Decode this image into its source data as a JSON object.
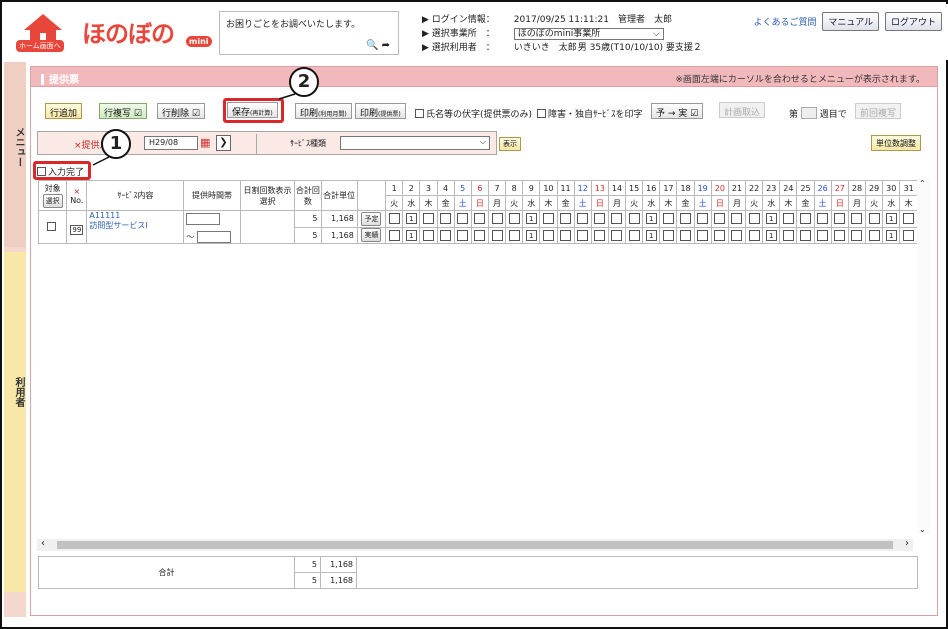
{
  "header": {
    "home_label": "ホーム画面へ",
    "logo_text": "ほのぼの",
    "logo_mini": "mini",
    "search_placeholder": "お困りごとをお調べいたします。",
    "login_label": "ログイン情報：",
    "login_value": "2017/09/25 11:11:21　管理者　太郎",
    "office_label": "選択事業所　：",
    "office_value": "ほのぼのmini事業所",
    "user_label": "選択利用者　：",
    "user_name": "いきいき　太郎",
    "user_detail": "男 35歳(T10/10/10) 要支援２",
    "faq": "よくあるご質問",
    "manual": "マニュアル",
    "logout": "ログアウト"
  },
  "side": {
    "menu": "メニュー",
    "user": "利用者"
  },
  "titlebar": {
    "title": "提供票",
    "note": "※画面左端にカーソルを合わせるとメニューが表示されます。"
  },
  "toolbar": {
    "add_row": "行追加",
    "copy_row": "行複写",
    "del_row": "行削除",
    "save": "保存",
    "save_sub": "(再計算)",
    "print1": "印刷",
    "print1_sub": "(利用月間)",
    "print2": "印刷",
    "print2_sub": "(提供票)",
    "opt_name": "氏名等の伏字(提供票のみ)",
    "opt_disab": "障害・独自ｻｰﾋﾞｽを印字",
    "plan_to_real": "予 → 実",
    "plan_import": "計画取込",
    "week_prefix": "第",
    "week_suffix": "週目で",
    "prev_copy": "前回複写"
  },
  "filter": {
    "month_label": "×提供月",
    "month_value": "H29/08",
    "service_label": "ｻｰﾋﾞｽ種類",
    "show": "表示",
    "unit_adjust": "単位数調整"
  },
  "input_done": "入力完了",
  "callouts": [
    "1",
    "2"
  ],
  "table": {
    "h_target": "対象",
    "h_select": "選択",
    "h_no_mark": "×",
    "h_no": "No.",
    "h_service": "ｻｰﾋﾞｽ内容",
    "h_time": "提供時間帯",
    "h_daycount": "日割回数表示選択",
    "h_total_count": "合計回数",
    "h_total_unit": "合計単位",
    "days": [
      "1",
      "2",
      "3",
      "4",
      "5",
      "6",
      "7",
      "8",
      "9",
      "10",
      "11",
      "12",
      "13",
      "14",
      "15",
      "16",
      "17",
      "18",
      "19",
      "20",
      "21",
      "22",
      "23",
      "24",
      "25",
      "26",
      "27",
      "28",
      "29",
      "30",
      "31"
    ],
    "weekdays": [
      "火",
      "水",
      "木",
      "金",
      "土",
      "日",
      "月",
      "火",
      "水",
      "木",
      "金",
      "土",
      "日",
      "月",
      "火",
      "水",
      "木",
      "金",
      "土",
      "日",
      "月",
      "火",
      "水",
      "木",
      "金",
      "土",
      "日",
      "月",
      "火",
      "水",
      "木"
    ],
    "row": {
      "no": "99",
      "code": "A11111",
      "service": "訪問型サービスⅠ",
      "tilde": "～",
      "plan_label": "予定",
      "real_label": "実績",
      "plan_count": "5",
      "plan_unit": "1,168",
      "real_count": "5",
      "real_unit": "1,168",
      "marked_days": [
        2,
        9,
        16,
        23,
        30
      ],
      "mark": "1"
    },
    "footer": {
      "label": "合計",
      "count1": "5",
      "unit1": "1,168",
      "count2": "5",
      "unit2": "1,168"
    }
  }
}
